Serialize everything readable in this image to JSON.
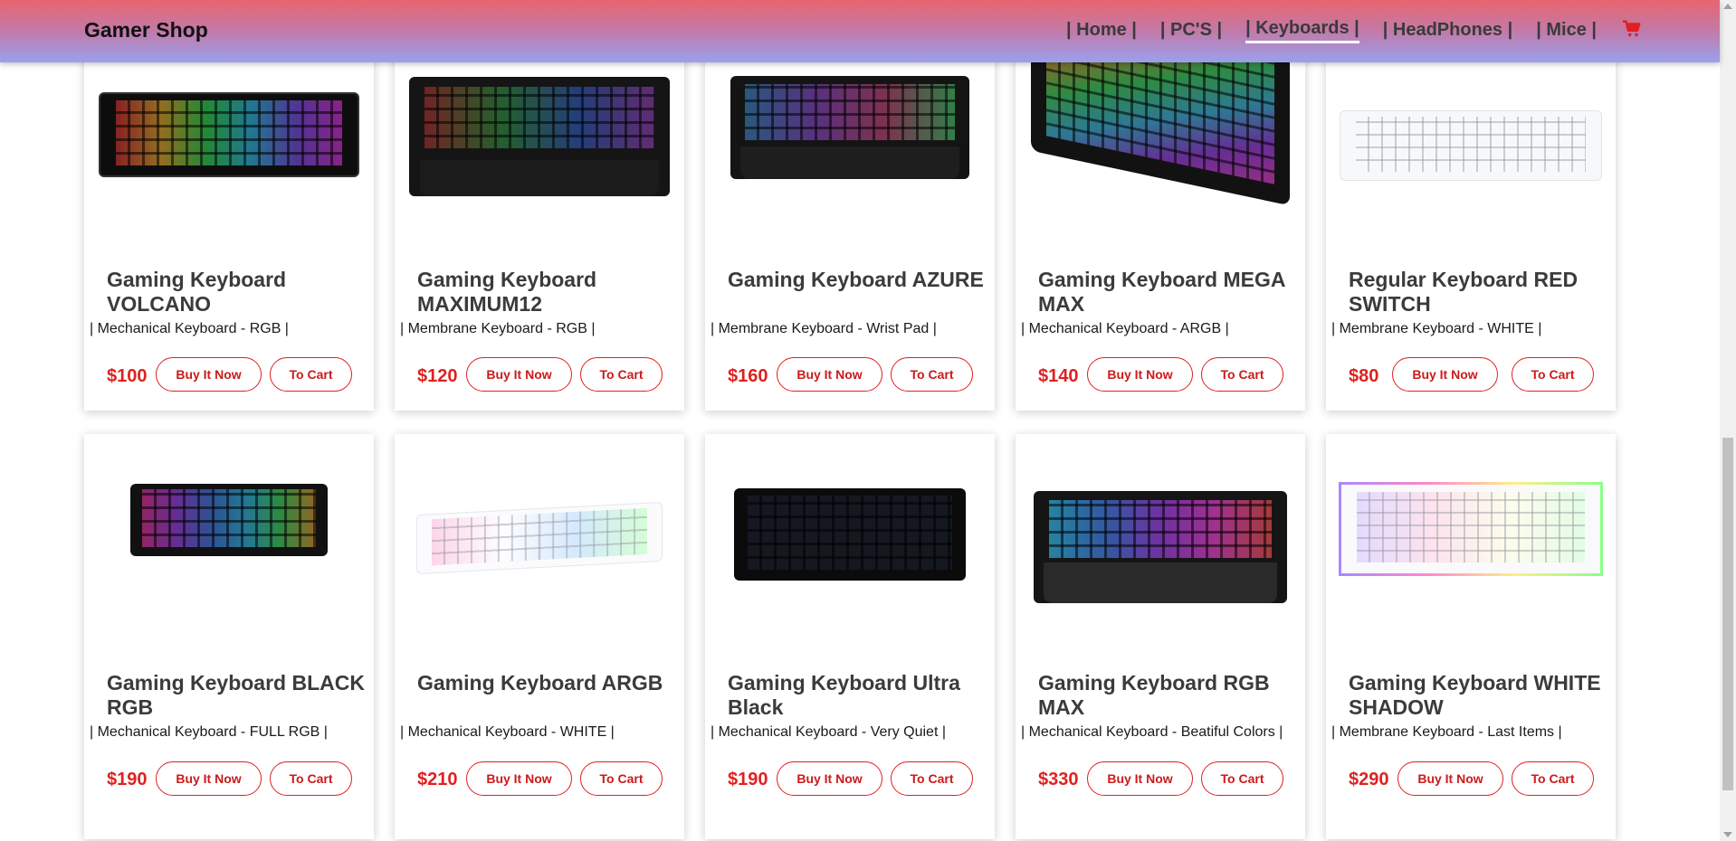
{
  "header": {
    "brand": "Gamer Shop",
    "nav": [
      {
        "label": "| Home |",
        "active": false
      },
      {
        "label": "| PC'S |",
        "active": false
      },
      {
        "label": "| Keyboards |",
        "active": true
      },
      {
        "label": "| HeadPhones |",
        "active": false
      },
      {
        "label": "| Mice |",
        "active": false
      }
    ],
    "cart_icon": "shopping-cart-icon",
    "accent_color": "#e02020"
  },
  "buttons": {
    "buy_label": "Buy It Now",
    "cart_label": "To Cart"
  },
  "products": [
    {
      "name": "Gaming Keyboard VOLCANO",
      "description": "| Mechanical Keyboard - RGB |",
      "price": "$100"
    },
    {
      "name": "Gaming Keyboard MAXIMUM12",
      "description": "| Membrane Keyboard - RGB |",
      "price": "$120"
    },
    {
      "name": "Gaming Keyboard AZURE",
      "description": "| Membrane Keyboard - Wrist Pad |",
      "price": "$160"
    },
    {
      "name": "Gaming Keyboard MEGA MAX",
      "description": "| Mechanical Keyboard - ARGB |",
      "price": "$140"
    },
    {
      "name": "Regular Keyboard RED SWITCH",
      "description": "| Membrane Keyboard - WHITE |",
      "price": "$80"
    },
    {
      "name": "Gaming Keyboard BLACK RGB",
      "description": "| Mechanical Keyboard - FULL RGB |",
      "price": "$190"
    },
    {
      "name": "Gaming Keyboard ARGB",
      "description": "| Mechanical Keyboard - WHITE |",
      "price": "$210"
    },
    {
      "name": "Gaming Keyboard Ultra Black",
      "description": "| Mechanical Keyboard - Very Quiet |",
      "price": "$190"
    },
    {
      "name": "Gaming Keyboard RGB MAX",
      "description": "| Mechanical Keyboard - Beatiful Colors |",
      "price": "$330"
    },
    {
      "name": "Gaming Keyboard WHITE SHADOW",
      "description": "| Membrane Keyboard - Last Items |",
      "price": "$290"
    }
  ]
}
